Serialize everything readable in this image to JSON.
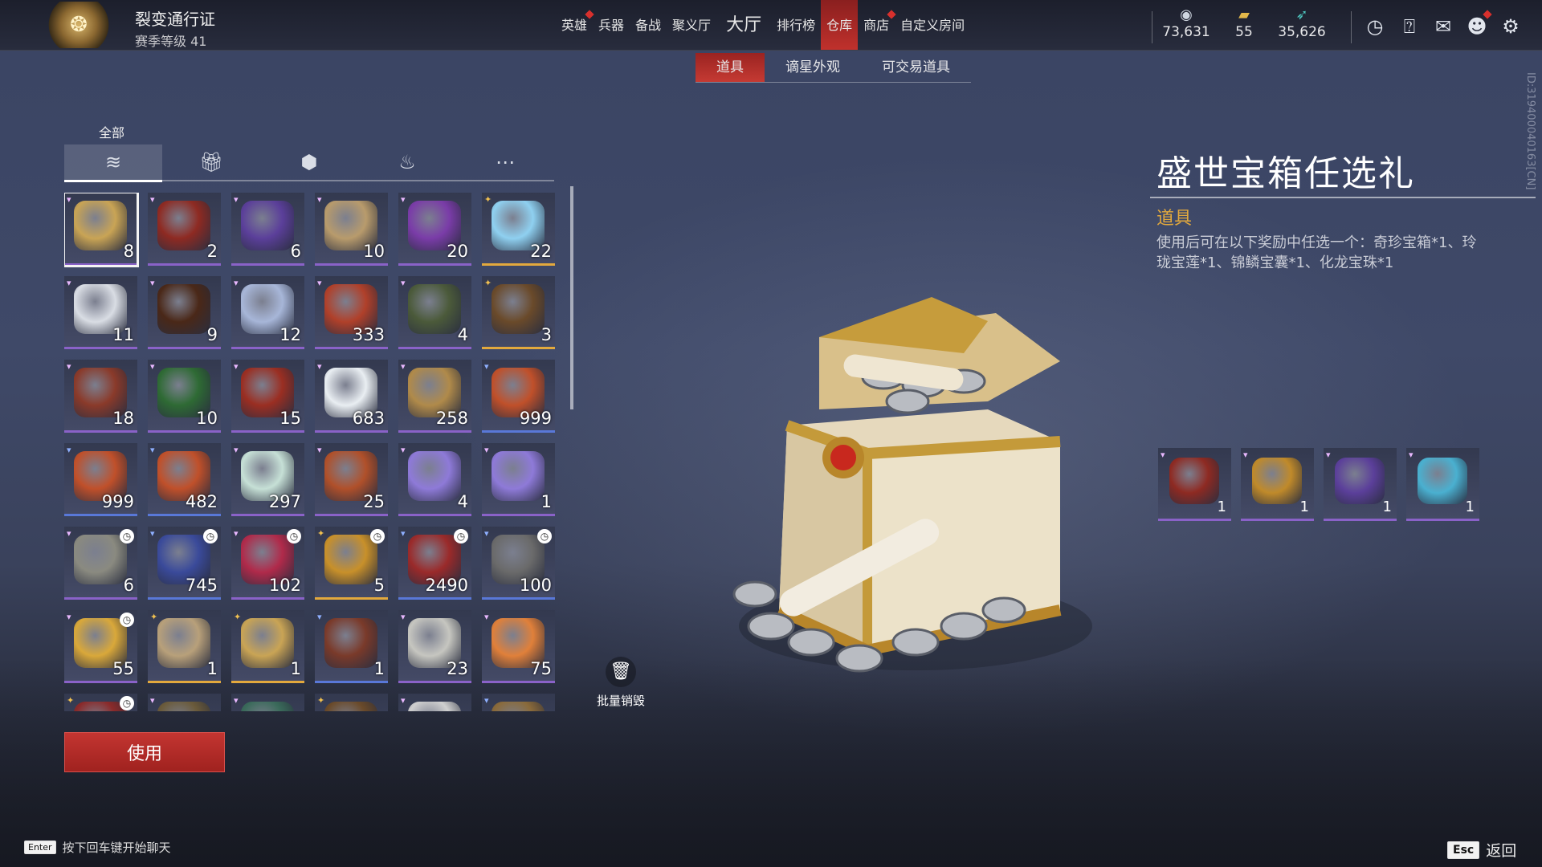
{
  "header": {
    "pass_title": "裂变通行证",
    "pass_level": "赛季等级 41",
    "nav": [
      {
        "label": "英雄",
        "dot": true
      },
      {
        "label": "兵器",
        "dot": false
      },
      {
        "label": "备战",
        "dot": false
      },
      {
        "label": "聚义厅",
        "dot": false
      },
      {
        "label": "大厅",
        "dot": false,
        "big": true
      },
      {
        "label": "排行榜",
        "dot": false
      },
      {
        "label": "仓库",
        "dot": false,
        "active": true
      },
      {
        "label": "商店",
        "dot": true
      },
      {
        "label": "自定义房间",
        "dot": false
      }
    ],
    "currencies": [
      {
        "icon": "coin-stack-icon",
        "value": "73,631"
      },
      {
        "icon": "gold-ingot-icon",
        "value": "55"
      },
      {
        "icon": "feather-icon",
        "value": "35,626"
      }
    ],
    "icons": [
      "clock-icon",
      "help-icon",
      "mail-icon",
      "friends-icon",
      "settings-icon"
    ]
  },
  "subtabs": [
    {
      "label": "道具",
      "active": true
    },
    {
      "label": "谪星外观",
      "active": false
    },
    {
      "label": "可交易道具",
      "active": false
    }
  ],
  "categories": {
    "active_label": "全部",
    "tabs": [
      "all-layers-icon",
      "gift-icon",
      "badge-icon",
      "flame-icon",
      "more-icon"
    ]
  },
  "inventory": [
    {
      "count": "8",
      "rarity": "purple",
      "selected": true,
      "color": "#c9a455"
    },
    {
      "count": "2",
      "rarity": "purple",
      "color": "#8e2a22"
    },
    {
      "count": "6",
      "rarity": "purple",
      "color": "#5b3f9a"
    },
    {
      "count": "10",
      "rarity": "purple",
      "color": "#b89b6c"
    },
    {
      "count": "20",
      "rarity": "purple",
      "color": "#7a3ca8"
    },
    {
      "count": "22",
      "rarity": "gold",
      "color": "#8fd0f0"
    },
    {
      "count": "11",
      "rarity": "purple",
      "color": "#d9dde4"
    },
    {
      "count": "9",
      "rarity": "purple",
      "color": "#4a2818"
    },
    {
      "count": "12",
      "rarity": "purple",
      "color": "#a7b6d8"
    },
    {
      "count": "333",
      "rarity": "purple",
      "color": "#b0402a"
    },
    {
      "count": "4",
      "rarity": "purple",
      "color": "#4b5a3a"
    },
    {
      "count": "3",
      "rarity": "gold",
      "color": "#6a4a2a"
    },
    {
      "count": "18",
      "rarity": "purple",
      "color": "#8a3a2a"
    },
    {
      "count": "10",
      "rarity": "purple",
      "color": "#2e6a34"
    },
    {
      "count": "15",
      "rarity": "purple",
      "color": "#9a2e22"
    },
    {
      "count": "683",
      "rarity": "purple",
      "color": "#e9eef2"
    },
    {
      "count": "258",
      "rarity": "purple",
      "color": "#b08a4a"
    },
    {
      "count": "999",
      "rarity": "blue",
      "color": "#c0502a"
    },
    {
      "count": "999",
      "rarity": "blue",
      "color": "#c0502a"
    },
    {
      "count": "482",
      "rarity": "blue",
      "color": "#c0502a"
    },
    {
      "count": "297",
      "rarity": "purple",
      "color": "#c6e0d6"
    },
    {
      "count": "25",
      "rarity": "purple",
      "color": "#b0502a"
    },
    {
      "count": "4",
      "rarity": "purple",
      "color": "#8e7ad8"
    },
    {
      "count": "1",
      "rarity": "purple",
      "color": "#8e7ad8"
    },
    {
      "count": "6",
      "rarity": "purple",
      "timer": true,
      "color": "#8a8a80"
    },
    {
      "count": "745",
      "rarity": "blue",
      "timer": true,
      "color": "#3a4a9a"
    },
    {
      "count": "102",
      "rarity": "purple",
      "timer": true,
      "color": "#b02a4a"
    },
    {
      "count": "5",
      "rarity": "gold",
      "timer": true,
      "color": "#c8902a"
    },
    {
      "count": "2490",
      "rarity": "blue",
      "timer": true,
      "color": "#9a2a2a"
    },
    {
      "count": "100",
      "rarity": "blue",
      "timer": true,
      "color": "#6a6a6a"
    },
    {
      "count": "55",
      "rarity": "purple",
      "timer": true,
      "color": "#d9a83a"
    },
    {
      "count": "1",
      "rarity": "gold",
      "color": "#b8a07a"
    },
    {
      "count": "1",
      "rarity": "gold",
      "color": "#c9a455"
    },
    {
      "count": "1",
      "rarity": "blue",
      "color": "#7a3a2a"
    },
    {
      "count": "23",
      "rarity": "purple",
      "color": "#c6c6c0"
    },
    {
      "count": "75",
      "rarity": "purple",
      "color": "#e0803a"
    },
    {
      "count": "",
      "rarity": "gold",
      "timer": true,
      "color": "#8a2a2a"
    },
    {
      "count": "",
      "rarity": "purple",
      "color": "#6a5a3a"
    },
    {
      "count": "",
      "rarity": "purple",
      "color": "#3a6a5a"
    },
    {
      "count": "",
      "rarity": "gold",
      "color": "#6a4a2a"
    },
    {
      "count": "",
      "rarity": "purple",
      "color": "#d0d0d0"
    },
    {
      "count": "",
      "rarity": "blue",
      "color": "#8a6a3a"
    }
  ],
  "actions": {
    "use_label": "使用",
    "destroy_label": "批量销毁"
  },
  "detail": {
    "title": "盛世宝箱任选礼",
    "type": "道具",
    "description": "使用后可在以下奖励中任选一个：奇珍宝箱*1、玲珑宝莲*1、锦鳞宝囊*1、化龙宝珠*1",
    "rewards": [
      {
        "count": "1",
        "color": "#8e2a22"
      },
      {
        "count": "1",
        "color": "#c08a2a"
      },
      {
        "count": "1",
        "color": "#5b3f9a"
      },
      {
        "count": "1",
        "color": "#4ab0d0"
      }
    ]
  },
  "uid": "ID:319400040163[CN]",
  "footer": {
    "enter_key": "Enter",
    "chat_hint": "按下回车键开始聊天",
    "esc_key": "Esc",
    "back_label": "返回"
  }
}
